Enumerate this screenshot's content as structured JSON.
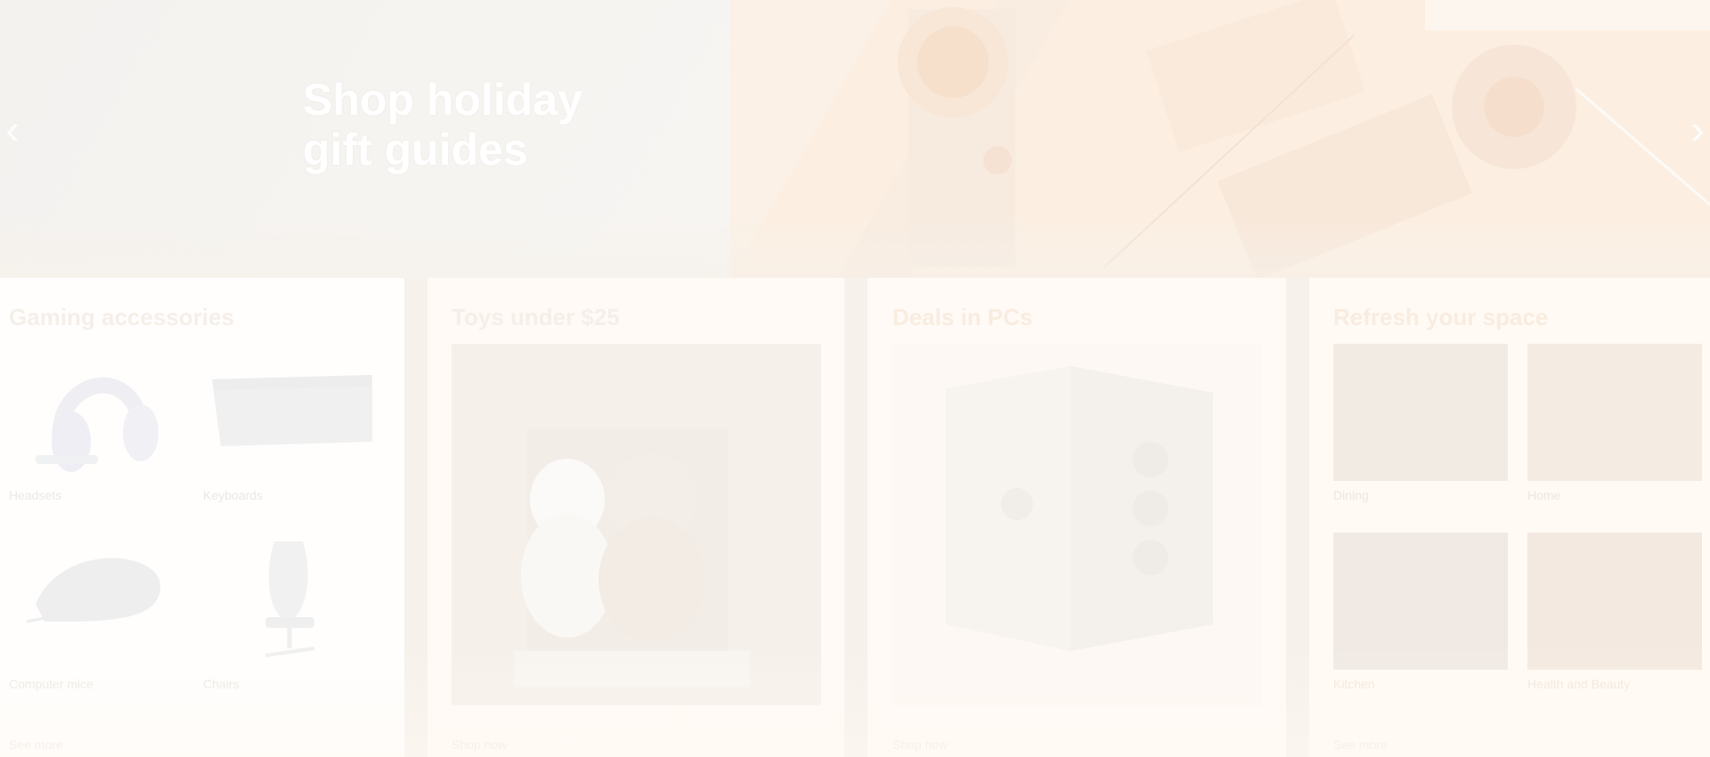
{
  "hero": {
    "title_line1": "Shop holiday",
    "title_line2": "gift guides",
    "prev_label": "‹",
    "next_label": "›"
  },
  "cards": [
    {
      "title": "Gaming accessories",
      "tiles": [
        {
          "label": "Headsets",
          "icon": "headset-icon"
        },
        {
          "label": "Keyboards",
          "icon": "keyboard-icon"
        },
        {
          "label": "Computer mice",
          "icon": "mouse-icon"
        },
        {
          "label": "Chairs",
          "icon": "chair-icon"
        }
      ],
      "link": "See more"
    },
    {
      "title": "Toys under $25",
      "image": "plush-toys",
      "link": "Shop now"
    },
    {
      "title": "Deals in PCs",
      "image": "pc-tower",
      "link": "Shop now"
    },
    {
      "title": "Refresh your space",
      "tiles": [
        {
          "label": "Dining",
          "icon": "dining-photo"
        },
        {
          "label": "Home",
          "icon": "home-photo"
        },
        {
          "label": "Kitchen",
          "icon": "kitchen-photo"
        },
        {
          "label": "Health and Beauty",
          "icon": "health-beauty-photo"
        }
      ],
      "link": "See more"
    }
  ],
  "colors": {
    "background": "#f6f1ea",
    "card": "#fffaf5",
    "hero_text": "#ffffff",
    "faded_text": "#ebe8e3"
  }
}
